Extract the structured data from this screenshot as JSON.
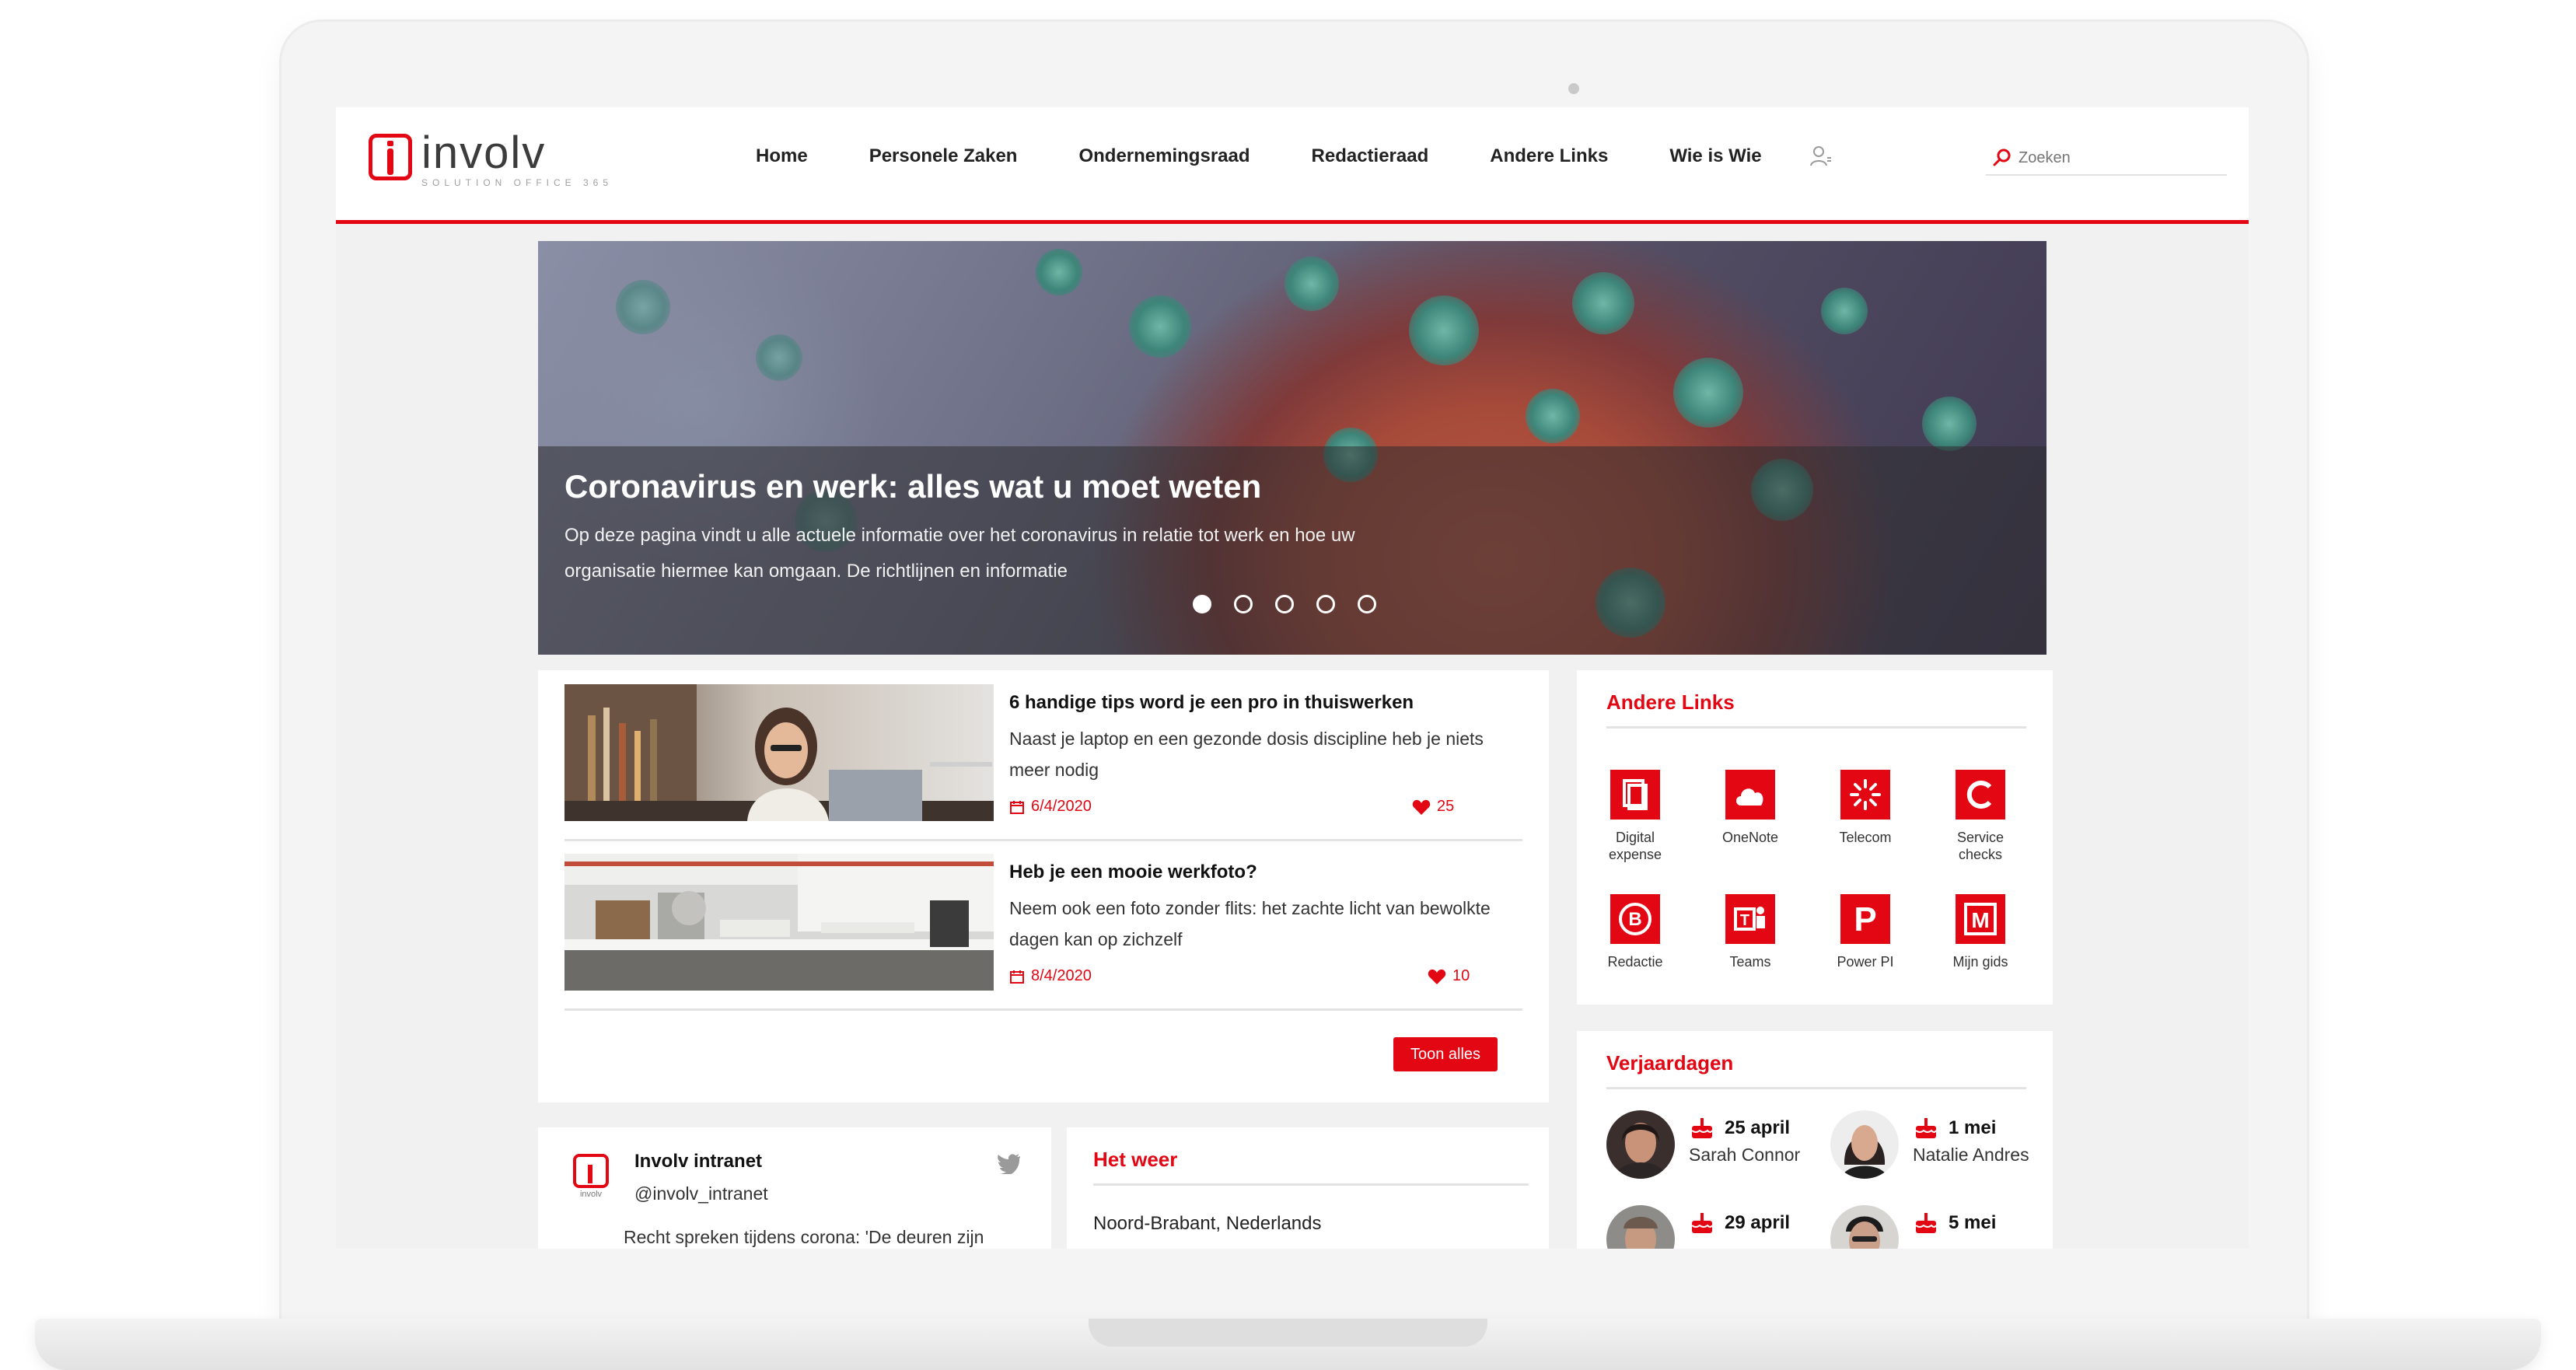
{
  "brand": {
    "name": "involv",
    "tagline": "SOLUTION OFFICE 365",
    "accent": "#e30613"
  },
  "nav": {
    "items": [
      "Home",
      "Personele Zaken",
      "Ondernemingsraad",
      "Redactieraad",
      "Andere Links",
      "Wie is Wie"
    ],
    "user_icon": "user-icon"
  },
  "search": {
    "placeholder": "Zoeken",
    "icon": "search-icon"
  },
  "hero": {
    "title": "Coronavirus en werk: alles wat u moet weten",
    "text": "Op deze pagina vindt u alle actuele informatie over het coronavirus in relatie tot werk en hoe uw organisatie hiermee kan omgaan. De richtlijnen en informatie",
    "slides": 5,
    "active_slide": 1
  },
  "news": {
    "items": [
      {
        "title": "6 handige tips word je een pro in thuiswerken",
        "body": "Naast je laptop en een gezonde dosis discipline heb je niets meer nodig",
        "date": "6/4/2020",
        "likes": "25"
      },
      {
        "title": "Heb je een mooie werkfoto?",
        "body": "Neem ook een foto zonder flits: het zachte licht van bewolkte dagen kan op zichzelf",
        "date": "8/4/2020",
        "likes": "10"
      }
    ],
    "show_all_label": "Toon alles"
  },
  "links": {
    "title": "Andere Links",
    "tiles": [
      {
        "label": "Digital expense",
        "icon": "document-icon"
      },
      {
        "label": "OneNote",
        "icon": "cloud-icon"
      },
      {
        "label": "Telecom",
        "icon": "telecom-icon"
      },
      {
        "label": "Service checks",
        "icon": "service-c-icon"
      },
      {
        "label": "Redactie",
        "icon": "redactie-b-icon"
      },
      {
        "label": "Teams",
        "icon": "teams-icon"
      },
      {
        "label": "Power PI",
        "icon": "power-p-icon"
      },
      {
        "label": "Mijn gids",
        "icon": "mijn-m-icon"
      }
    ]
  },
  "birthdays": {
    "title": "Verjaardagen",
    "people": [
      {
        "date": "25 april",
        "name": "Sarah Connor"
      },
      {
        "date": "1 mei",
        "name": "Natalie Andres"
      },
      {
        "date": "29 april",
        "name": ""
      },
      {
        "date": "5 mei",
        "name": ""
      }
    ]
  },
  "twitter": {
    "name": "Involv intranet",
    "handle": "@involv_intranet",
    "logo_text": "involv",
    "text": "Recht spreken tijdens corona: 'De deuren zijn"
  },
  "weather": {
    "title": "Het weer",
    "location": "Noord-Brabant, Nederlands"
  }
}
